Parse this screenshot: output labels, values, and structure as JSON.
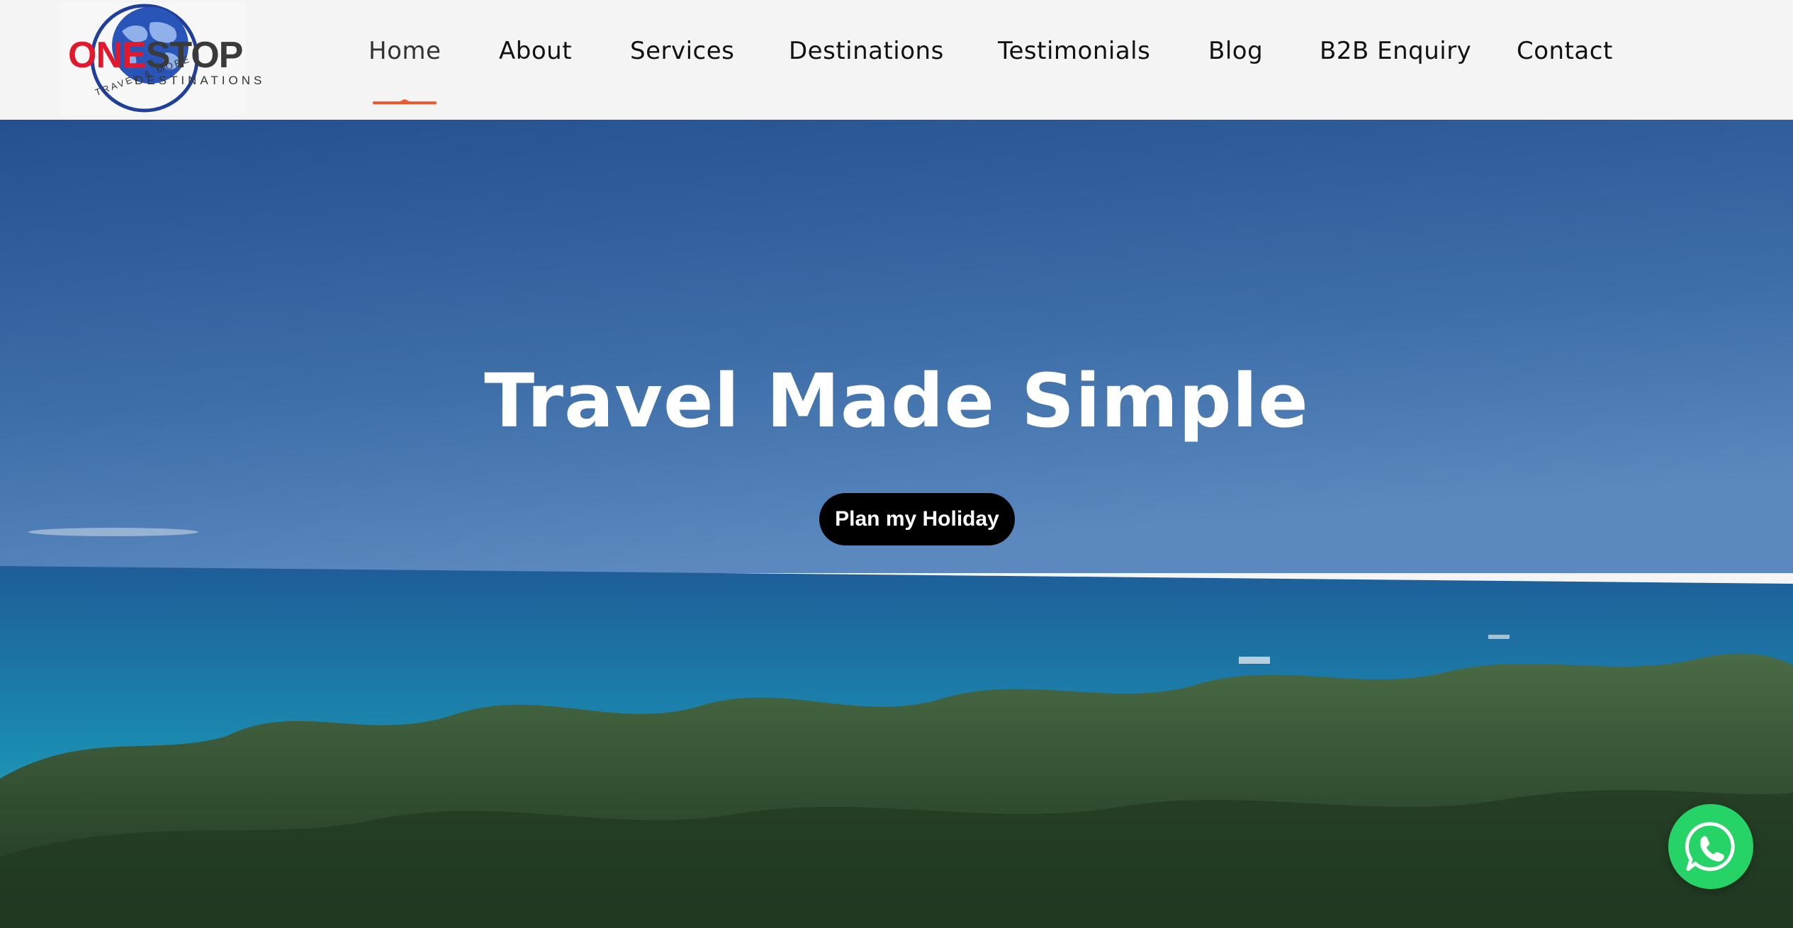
{
  "logo": {
    "brand_one": "ONE",
    "brand_stop": "STOP",
    "subtitle": "DESTINATIONS",
    "tagline": "TRAVEL & MORE"
  },
  "nav": {
    "items": [
      {
        "label": "Home",
        "active": true
      },
      {
        "label": "About"
      },
      {
        "label": "Services"
      },
      {
        "label": "Destinations"
      },
      {
        "label": "Testimonials"
      },
      {
        "label": "Blog"
      },
      {
        "label": "B2B Enquiry"
      },
      {
        "label": "Contact"
      }
    ]
  },
  "hero": {
    "title": "Travel Made Simple",
    "cta_label": "Plan my Holiday"
  },
  "floating": {
    "whatsapp_icon": "whatsapp-icon"
  },
  "colors": {
    "accent": "#e8582a",
    "whatsapp": "#25d366",
    "cta_bg": "#000000"
  }
}
